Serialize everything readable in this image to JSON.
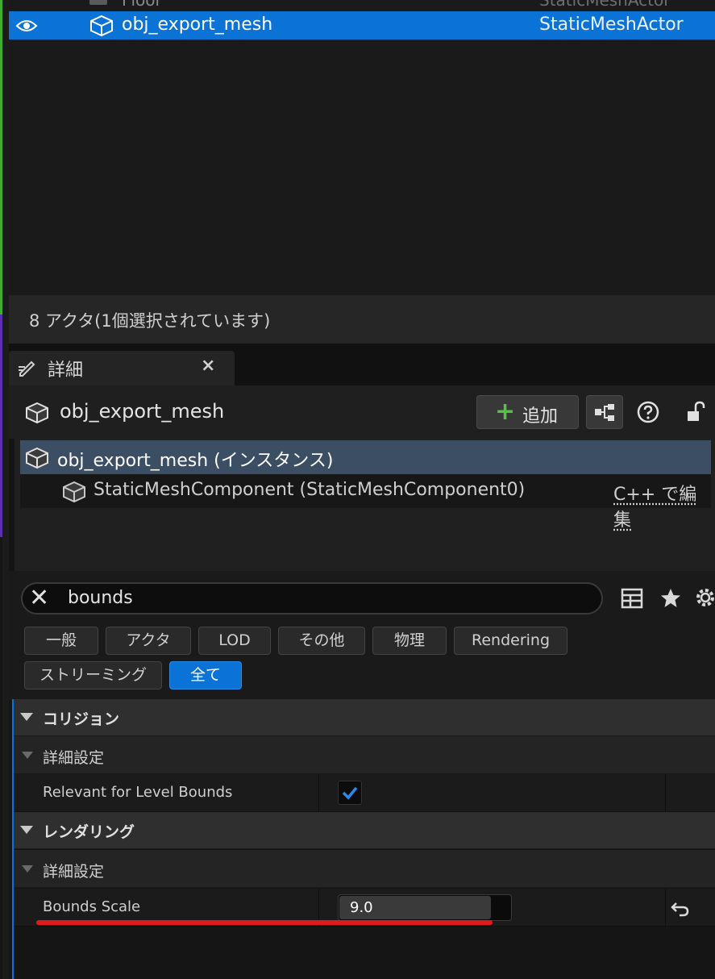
{
  "outliner": {
    "clipped_row": {
      "name": "Floor",
      "type": "StaticMeshActor"
    },
    "selected_row": {
      "name": "obj_export_mesh",
      "type": "StaticMeshActor"
    },
    "status": "8 アクタ(1個選択されています)"
  },
  "details_tab": {
    "title": "詳細",
    "close": "×"
  },
  "details": {
    "actor_name": "obj_export_mesh",
    "add_label": "追加",
    "components": [
      {
        "label": "obj_export_mesh (インスタンス)"
      },
      {
        "label": "StaticMeshComponent (StaticMeshComponent0)",
        "edit_link": "C++ で編集"
      }
    ]
  },
  "search": {
    "value": "bounds"
  },
  "filters": [
    "一般",
    "アクタ",
    "LOD",
    "その他",
    "物理",
    "Rendering",
    "ストリーミング",
    "全て"
  ],
  "active_filter": "全て",
  "properties": {
    "collision": {
      "section": "コリジョン",
      "advanced": "詳細設定",
      "relevant_label": "Relevant for Level Bounds",
      "relevant_checked": true
    },
    "rendering": {
      "section": "レンダリング",
      "advanced": "詳細設定",
      "bounds_scale_label": "Bounds Scale",
      "bounds_scale_value": "9.0"
    }
  },
  "colors": {
    "accent": "#0b73d5",
    "add_plus": "#55c244",
    "highlight_underline": "#e01b1b"
  },
  "icons": [
    "eye-icon",
    "static-mesh-icon",
    "pencil-icon",
    "close-icon",
    "plus-icon",
    "blueprint-icon",
    "help-icon",
    "lock-icon",
    "clear-search-icon",
    "table-icon",
    "star-icon",
    "gear-icon",
    "reset-icon",
    "checkmark-icon"
  ]
}
